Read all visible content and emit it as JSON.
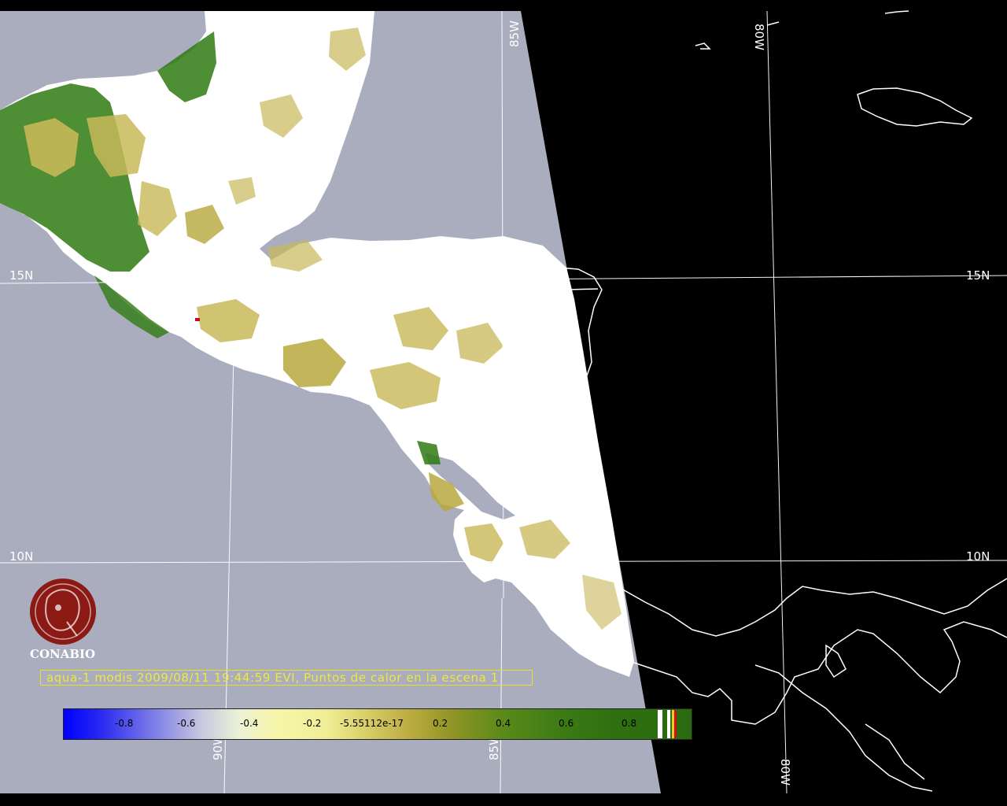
{
  "grid_labels": {
    "lat_15_left": "15N",
    "lat_15_right": "15N",
    "lat_10_left": "10N",
    "lat_10_right": "10N",
    "lon_85_top": "85W",
    "lon_80_top": "80W",
    "lon_90_bottom": "90W",
    "lon_85_bottom": "85W",
    "lon_80_bottom": "80W"
  },
  "logo": {
    "text": "CONABIO",
    "icon": "conabio-seal-icon"
  },
  "caption": "aqua-1 modis 2009/08/11 19:44:59 EVI, Puntos de calor en la escena 1",
  "colorbar": {
    "ticks": [
      "-0.8",
      "-0.6",
      "-0.4",
      "-0.2",
      "-5.55112e-17",
      "0.2",
      "0.4",
      "0.6",
      "0.8"
    ],
    "range": [
      -1.0,
      1.0
    ]
  },
  "colors": {
    "ocean": "#a9adbe",
    "cloud": "#ffffff",
    "no_data": "#000000",
    "vegetation_low": "#c8b858",
    "vegetation_high": "#2f7a12",
    "caption": "#f0e838",
    "logo": "#8b1a14"
  }
}
